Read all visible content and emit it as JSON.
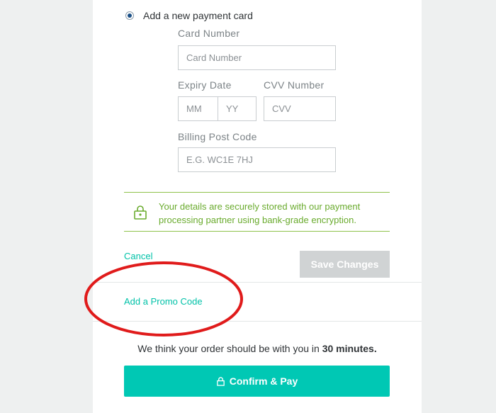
{
  "payment": {
    "new_card_label": "Add a new payment card",
    "card_number": {
      "label": "Card Number",
      "placeholder": "Card Number",
      "value": ""
    },
    "expiry": {
      "label": "Expiry Date",
      "mm_placeholder": "MM",
      "yy_placeholder": "YY"
    },
    "cvv": {
      "label": "CVV Number",
      "placeholder": "CVV"
    },
    "postcode": {
      "label": "Billing Post Code",
      "placeholder": "E.G. WC1E 7HJ"
    }
  },
  "security_notice": "Your details are securely stored with our payment processing partner using bank-grade encryption.",
  "actions": {
    "cancel_label": "Cancel",
    "save_label": "Save Changes"
  },
  "promo": {
    "label": "Add a Promo Code"
  },
  "delivery": {
    "prefix": "We think your order should be with you in ",
    "time": "30 minutes."
  },
  "confirm": {
    "label": "Confirm & Pay"
  },
  "colors": {
    "accent": "#00c8b4",
    "secure_green": "#6aab2e",
    "annotation_red": "#e01b1b"
  }
}
